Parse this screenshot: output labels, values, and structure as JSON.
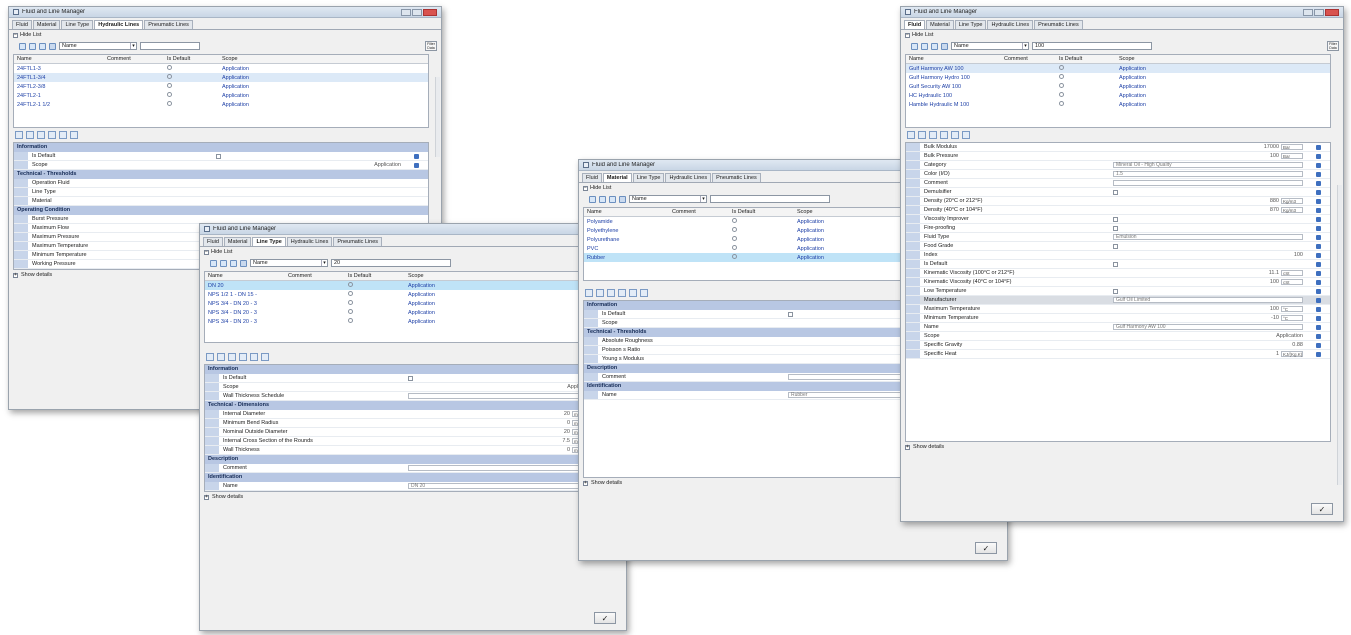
{
  "common": {
    "app_title": "Fluid and Line Manager",
    "tabs": [
      "Fluid",
      "Material",
      "Line Type",
      "Hydraulic Lines",
      "Pneumatic Lines"
    ],
    "hide_list": "Hide List",
    "show_details": "Show details",
    "filter_button": "Filter Data",
    "ok_label": "✓",
    "list_columns": [
      "Name",
      "Comment",
      "Is Default",
      "Scope"
    ]
  },
  "win1": {
    "active_tab": "Hydraulic Lines",
    "select_value": "Name",
    "filter_value": "",
    "rows": [
      {
        "name": "24FTL1-3",
        "scope": "Application"
      },
      {
        "name": "24FTL1-3/4",
        "scope": "Application"
      },
      {
        "name": "24FTL2-3/8",
        "scope": "Application"
      },
      {
        "name": "24FTL2-1",
        "scope": "Application"
      },
      {
        "name": "24FTL2-1 1/2",
        "scope": "Application"
      }
    ],
    "props": [
      {
        "cat": "Information"
      },
      {
        "label": "Is Default",
        "kind": "cb"
      },
      {
        "label": "Scope",
        "value": "Application"
      },
      {
        "cat": "Technical - Thresholds"
      },
      {
        "label": "Operation Fluid"
      },
      {
        "label": "Line Type"
      },
      {
        "label": "Material"
      },
      {
        "cat": "Operating Condition"
      },
      {
        "label": "Burst Pressure"
      },
      {
        "label": "Maximum Flow"
      },
      {
        "label": "Maximum Pressure"
      },
      {
        "label": "Maximum Temperature"
      },
      {
        "label": "Minimum Temperature"
      },
      {
        "label": "Working Pressure"
      }
    ]
  },
  "win2": {
    "active_tab": "Line Type",
    "select_value": "Name",
    "filter_value": "20",
    "rows": [
      {
        "name": "DN 20",
        "scope": "Application",
        "hl": true
      },
      {
        "name": "NPS 1/2 1 - DN 15 -",
        "scope": "Application"
      },
      {
        "name": "NPS 3/4 - DN 20 - 3",
        "scope": "Application"
      },
      {
        "name": "NPS 3/4 - DN 20 - 3",
        "scope": "Application"
      },
      {
        "name": "NPS 3/4 - DN 20 - 3",
        "scope": "Application"
      }
    ],
    "props": [
      {
        "cat": "Information"
      },
      {
        "label": "Is Default",
        "kind": "cb"
      },
      {
        "label": "Scope",
        "value": "Application"
      },
      {
        "label": "Wall Thickness Schedule",
        "kind": "box",
        "value": ""
      },
      {
        "cat": "Technical - Dimensions"
      },
      {
        "label": "Internal Diameter",
        "value": "20",
        "unit": "mm"
      },
      {
        "label": "Minimum Bend Radius",
        "value": "0",
        "unit": "mm"
      },
      {
        "label": "Nominal Outside Diameter",
        "value": "20",
        "unit": "mm"
      },
      {
        "label": "Internal Cross Section of the Rounds",
        "value": "7.5",
        "unit": "mm2"
      },
      {
        "label": "Wall Thickness",
        "value": "0",
        "unit": "mm"
      },
      {
        "cat": "Description"
      },
      {
        "label": "Comment",
        "kind": "box",
        "value": ""
      },
      {
        "cat": "Identification"
      },
      {
        "label": "Name",
        "kind": "box",
        "value": "DN 20"
      }
    ]
  },
  "win3": {
    "active_tab": "Material",
    "select_value": "Name",
    "filter_value": "",
    "rows": [
      {
        "name": "Polyamide",
        "scope": "Application"
      },
      {
        "name": "Polyethylene",
        "scope": "Application"
      },
      {
        "name": "Polyurethane",
        "scope": "Application"
      },
      {
        "name": "PVC",
        "scope": "Application"
      },
      {
        "name": "Rubber",
        "scope": "Application",
        "hl": true
      }
    ],
    "props": [
      {
        "cat": "Information"
      },
      {
        "label": "Is Default",
        "kind": "cb"
      },
      {
        "label": "Scope",
        "value": "Application"
      },
      {
        "cat": "Technical - Thresholds"
      },
      {
        "label": "Absolute Roughness",
        "value": "0.0015",
        "unit": "mm"
      },
      {
        "label": "Poisson s Ratio",
        "value": "0.5"
      },
      {
        "label": "Young s Modulus",
        "value": "100",
        "unit": "Bar"
      },
      {
        "cat": "Description"
      },
      {
        "label": "Comment",
        "kind": "box",
        "value": ""
      },
      {
        "cat": "Identification"
      },
      {
        "label": "Name",
        "kind": "box",
        "value": "Rubber"
      }
    ]
  },
  "win4": {
    "active_tab": "Fluid",
    "select_value": "Name",
    "filter_value": "100",
    "rows": [
      {
        "name": "Gulf Harmony AW 100",
        "scope": "Application",
        "sel": true
      },
      {
        "name": "Gulf Harmony Hydro 100",
        "scope": "Application"
      },
      {
        "name": "Gulf Security AW 100",
        "scope": "Application"
      },
      {
        "name": "HC Hydraulic 100",
        "scope": "Application"
      },
      {
        "name": "Hamble Hydraulic M 100",
        "scope": "Application"
      }
    ],
    "props": [
      {
        "label": "Bulk Modulus",
        "value": "17000",
        "unit": "Bar"
      },
      {
        "label": "Bulk Pressure",
        "value": "100",
        "unit": "Bar"
      },
      {
        "label": "Category",
        "kind": "box",
        "value": "Mineral Oil - High Quality"
      },
      {
        "label": "Color (I/O)",
        "kind": "box",
        "value": "1.5"
      },
      {
        "label": "Comment",
        "kind": "box",
        "value": ""
      },
      {
        "label": "Demulsifier",
        "kind": "cb"
      },
      {
        "label": "Density (20°C or 212°F)",
        "value": "880",
        "unit": "Kg/m3"
      },
      {
        "label": "Density (40°C or 104°F)",
        "value": "870",
        "unit": "Kg/m3"
      },
      {
        "label": "Viscosity Improver",
        "kind": "cb"
      },
      {
        "label": "Fire-proofing",
        "kind": "cb"
      },
      {
        "label": "Fluid Type",
        "kind": "box",
        "value": "Emulsion"
      },
      {
        "label": "Food Grade",
        "kind": "cb"
      },
      {
        "label": "Index",
        "value": "100"
      },
      {
        "label": "Is Default",
        "kind": "cb"
      },
      {
        "label": "Kinematic Viscosity (100°C or 212°F)",
        "value": "11.1",
        "unit": "cSt"
      },
      {
        "label": "Kinematic Viscosity (40°C or 104°F)",
        "value": "100",
        "unit": "cSt"
      },
      {
        "label": "Low Temperature",
        "kind": "cb"
      },
      {
        "label": "Manufacturer",
        "kind": "box",
        "value": "Gulf Oil Limited",
        "sel": true
      },
      {
        "label": "Maximum Temperature",
        "value": "100",
        "unit": "°C"
      },
      {
        "label": "Minimum Temperature",
        "value": "-10",
        "unit": "°C"
      },
      {
        "label": "Name",
        "kind": "box",
        "value": "Gulf Harmony AW 100"
      },
      {
        "label": "Scope",
        "value": "Application"
      },
      {
        "label": "Specific Gravity",
        "value": "0.88"
      },
      {
        "label": "Specific Heat",
        "value": "1",
        "unit": "KJ/(Kg.K)"
      }
    ]
  }
}
